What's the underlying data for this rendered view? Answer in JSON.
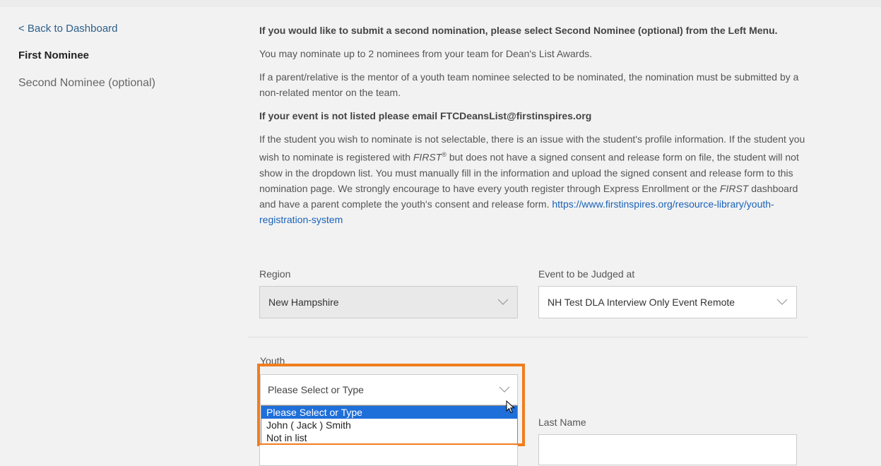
{
  "nav": {
    "back": "< Back to Dashboard",
    "items": [
      {
        "label": "First Nominee",
        "active": true
      },
      {
        "label": "Second Nominee (optional)",
        "active": false
      }
    ]
  },
  "intro": {
    "p1": "If you would like to submit a second nomination, please select Second Nominee (optional) from the Left Menu.",
    "p2": "You may nominate up to 2 nominees from your team for Dean's List Awards.",
    "p3": "If a parent/relative is the mentor of a youth team nominee selected to be nominated, the nomination must be submitted by a non-related mentor on the team.",
    "p4": "If your event is not listed please email FTCDeansList@firstinspires.org",
    "p5_a": "If the student you wish to nominate is not selectable, there is an issue with the student's profile information. If the student you wish to nominate is registered with ",
    "p5_first": "FIRST",
    "p5_reg": "®",
    "p5_b": " but does not have a signed consent and release form on file, the student will not show in the dropdown list. You must manually fill in the information and upload the signed consent and release form to this nomination page. We strongly encourage to have every youth register through Express Enrollment or the ",
    "p5_first2": "FIRST",
    "p5_c": " dashboard and have a parent complete the youth's consent and release form. ",
    "p5_link": "https://www.firstinspires.org/resource-library/youth-registration-system"
  },
  "form": {
    "region_label": "Region",
    "region_value": "New Hampshire",
    "event_label": "Event to be Judged at",
    "event_value": "NH Test DLA Interview Only Event Remote",
    "youth_label": "Youth",
    "youth_value": "Please Select or Type",
    "youth_options": [
      "Please Select or Type",
      "John ( Jack ) Smith",
      "Not in list"
    ],
    "last_name_label": "Last Name"
  },
  "colors": {
    "highlight": "#f07d1f",
    "selected_option": "#1e6fd9",
    "link": "#1a62b8"
  }
}
